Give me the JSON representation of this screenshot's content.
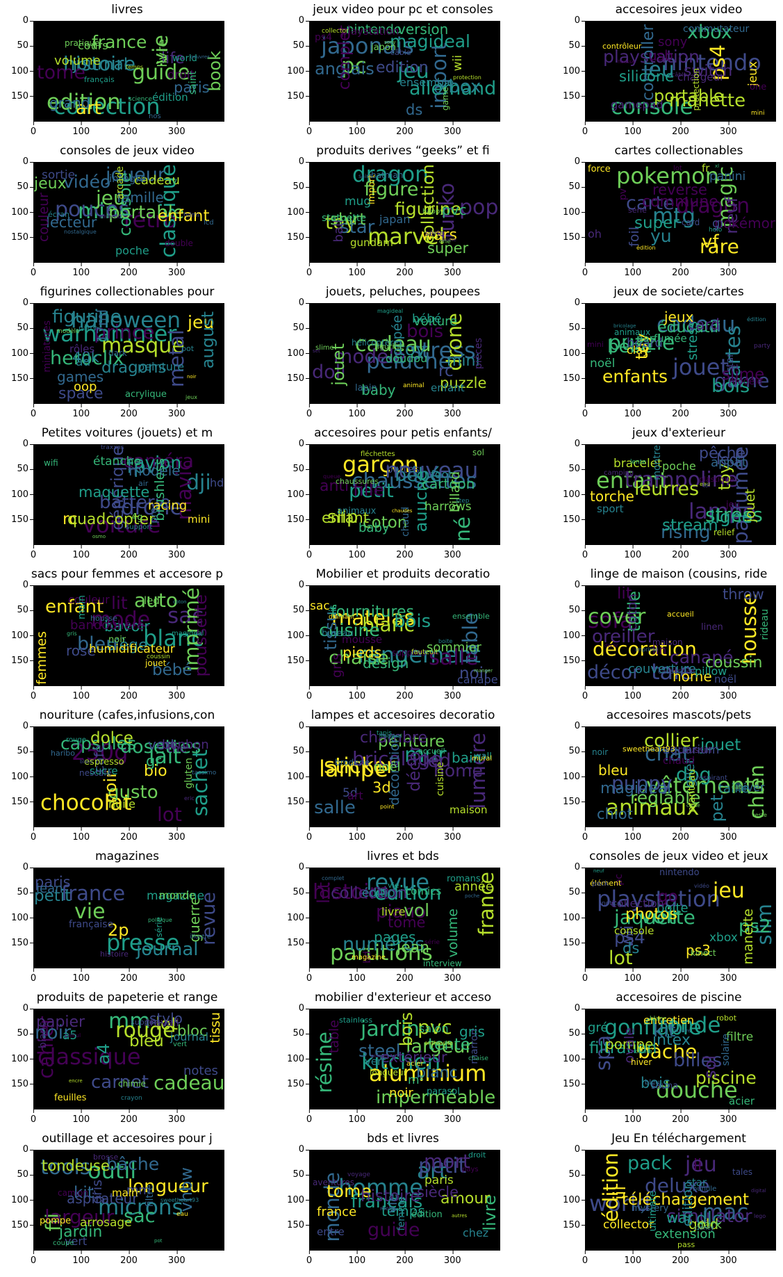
{
  "chart_data": {
    "type": "wordcloud",
    "layout": "8 rows x 3 columns grid of word clouds",
    "axes": {
      "yticks": [
        0,
        50,
        100,
        150
      ],
      "xticks": [
        0,
        100,
        200,
        300
      ],
      "ylim": [
        200,
        0
      ],
      "xlim": [
        0,
        400
      ]
    },
    "palette": [
      "#440154",
      "#482878",
      "#3e4a89",
      "#31688e",
      "#26828e",
      "#1f9e89",
      "#35b779",
      "#6ece58",
      "#b5de2b",
      "#fde725"
    ],
    "panels": [
      {
        "title": "livres",
        "words": [
          "collection",
          "edition",
          "guide",
          "vie",
          "histoire",
          "tome",
          "art",
          "france",
          "book",
          "journal",
          "life",
          "paris",
          "grand",
          "livre",
          "volume",
          "droit",
          "cours",
          "édition",
          "saint",
          "world",
          "pratique",
          "français",
          "nos",
          "science",
          "temps",
          "oeuvres"
        ]
      },
      {
        "title": "jeux video pour pc et consoles",
        "words": [
          "japonais",
          "pc",
          "jeu",
          "import",
          "allemand",
          "xbox",
          "magideal",
          "anglais",
          "complet",
          "edition",
          "ds",
          "version",
          "nintendo",
          "wii",
          "ensemble",
          "playstation",
          "ps4",
          "japon",
          "game",
          "câble",
          "collector",
          "protection",
          "sony"
        ]
      },
      {
        "title": "accesoires jeux video",
        "words": [
          "nintendo",
          "console",
          "jeu",
          "ps4",
          "xbox",
          "manette",
          "playstation",
          "portable",
          "controller",
          "switch",
          "silicone",
          "usb",
          "sony",
          "jeux",
          "gamepad",
          "chargeur",
          "commutateur",
          "one",
          "protection",
          "contrôleur",
          "mini",
          "câble",
          "housse"
        ]
      },
      {
        "title": "consoles de jeux video",
        "words": [
          "rétro",
          "mini",
          "pouces",
          "classique",
          "jeu",
          "joueur",
          "portable",
          "vidéo",
          "console",
          "enfant",
          "jeux",
          "lecteur",
          "famille",
          "couleur",
          "cadeau",
          "sortie",
          "poche",
          "intégré",
          "arcade",
          "tv",
          "double",
          "écran",
          "lcd",
          "hdmi",
          "nostalgique",
          "nintendo"
        ]
      },
      {
        "title": "produits derives “geeks” et fi",
        "words": [
          "marvel",
          "dragon",
          "pop",
          "funko",
          "toy",
          "figure",
          "star",
          "figurine",
          "collection",
          "shirt",
          "wars",
          "super",
          "pvc",
          "ball",
          "mug",
          "japan",
          "gundam",
          "statuette",
          "import",
          "batman",
          "série",
          "happy",
          "one",
          "saint",
          "anime"
        ]
      },
      {
        "title": "cartes collectionables",
        "words": [
          "pokemon",
          "mtg",
          "dragon",
          "magic",
          "rare",
          "carte",
          "vf",
          "yu",
          "neuf",
          "super",
          "commune",
          "reverse",
          "pokémon",
          "foil",
          "gi",
          "panini",
          "oh",
          "fr",
          "pv",
          "force",
          "card",
          "série",
          "lot",
          "holo",
          "édition",
          "xl"
        ]
      },
      {
        "title": "figurines collectionables pour",
        "words": [
          "warhammer",
          "halloween",
          "masque",
          "metal",
          "prince",
          "heroclix",
          "figurine",
          "jeu",
          "august",
          "dragons",
          "space",
          "40k",
          "games",
          "17ml",
          "oop",
          "ad",
          "peinture",
          "rôles",
          "miniatures",
          "acrylique",
          "dark",
          "pot",
          "party",
          "modèle",
          "jeux",
          "noir"
        ]
      },
      {
        "title": "jouets, peluches, poupees",
        "words": [
          "stress",
          "peluche",
          "cadeau",
          "drone",
          "modèle",
          "doll",
          "bois",
          "toy",
          "jouet",
          "rc",
          "mini",
          "puzzle",
          "baby",
          "poupée",
          "voiture",
          "bébé",
          "doudou",
          "enfant",
          "pièces",
          "lapin",
          "hélicoptère",
          "figurine",
          "slime",
          "animal",
          "magideal",
          "set"
        ]
      },
      {
        "title": "jeux de societe/cartes",
        "words": [
          "jouet",
          "cadeau",
          "puzzle",
          "cartes",
          "game",
          "bois",
          "bébé",
          "enfants",
          "toy",
          "slime",
          "éducatif",
          "card",
          "jeux",
          "stress",
          "board",
          "noël",
          "clay",
          "parfumée",
          "star",
          "modèle",
          "animaux",
          "mini",
          "set",
          "party",
          "édition",
          "bricolage"
        ]
      },
      {
        "title": "Petites voitures (jouets) et m",
        "words": [
          "voiture",
          "drone",
          "dji",
          "mavic",
          "fpv",
          "caméra",
          "batterie",
          "avion",
          "générique",
          "rc",
          "quadcopter",
          "maquette",
          "modèle",
          "brushless",
          "racing",
          "étanche",
          "hd",
          "mini",
          "pro",
          "4g",
          "wifi",
          "air",
          "support",
          "traxxas",
          "sac",
          "osmo"
        ]
      },
      {
        "title": "accesoires pour petis enfants/",
        "words": [
          "garçon",
          "nouveau",
          "chaussettes",
          "né",
          "petit",
          "bébé",
          "slip",
          "fille",
          "auucne",
          "coton",
          "anti",
          "enfant",
          "cartoon",
          "billard",
          "baby",
          "harrows",
          "foot",
          "bottes",
          "chaud",
          "animaux",
          "sol",
          "chaussures",
          "fléchettes",
          "step",
          "queue",
          "chaudes"
        ]
      },
      {
        "title": "jeux d'exterieur",
        "words": [
          "enfant",
          "lampe",
          "trampoline",
          "parfumée",
          "stress",
          "leurres",
          "rising",
          "ligne",
          "toy",
          "stream",
          "pêche",
          "led",
          "torche",
          "jouet",
          "appât",
          "bracelet",
          "poche",
          "sport",
          "montre",
          "jeu",
          "relief",
          "plastique",
          "camping",
          "lente",
          "eau",
          "t6"
        ]
      },
      {
        "title": "sacs pour femmes et accesore p",
        "words": [
          "blanc",
          "sac",
          "mode",
          "imprimé",
          "auto",
          "bleu",
          "enfant",
          "lit",
          "poussette",
          "bébé",
          "siège",
          "bavoir",
          "rose",
          "femmes",
          "bandoulière",
          "humidificateur",
          "couleur",
          "led",
          "main",
          "noir",
          "jouet",
          "housse",
          "magideal",
          "coussin",
          "gris",
          "coton"
        ]
      },
      {
        "title": "Mobilier et produits decoratio",
        "words": [
          "rangement",
          "salle",
          "matelas",
          "table",
          "blanc",
          "chaise",
          "bois",
          "cuisine",
          "tissu",
          "noir",
          "fournitures",
          "pieds",
          "design",
          "gris",
          "sommier",
          "sac",
          "canape",
          "mousse",
          "lit",
          "bureau",
          "supplies",
          "ensemble",
          "fauteuil",
          "diamant",
          "boite",
          "manger"
        ]
      },
      {
        "title": "linge de maison (cousins, ride",
        "words": [
          "taie",
          "sofa",
          "cover",
          "housse",
          "décoration",
          "décor",
          "oreiller",
          "canapé",
          "taille",
          "lit",
          "coussin",
          "throw",
          "home",
          "coton",
          "couverture",
          "lin",
          "pillow",
          "noël",
          "rideau",
          "linen",
          "maison",
          "accueil",
          "case",
          "festival",
          "imprimé",
          "décor"
        ]
      },
      {
        "title": "nouriture (cafes,infusions,con",
        "words": [
          "250g",
          "chocolat",
          "lait",
          "sachet",
          "lot",
          "dosettes",
          "gusto",
          "capsules",
          "noir",
          "dolce",
          "bio",
          "gr",
          "vert",
          "café",
          "bonbon",
          "thé",
          "huile",
          "sucre",
          "gluten",
          "espresso",
          "nescafé",
          "haribo",
          "rouge",
          "tassimo",
          "eric",
          "blanc"
        ]
      },
      {
        "title": "lampes et accesoires decoratio",
        "words": [
          "lampe",
          "sticker",
          "mur",
          "lumière",
          "bricolage",
          "led",
          "salle",
          "home",
          "décor",
          "peinture",
          "chambre",
          "3d",
          "bain",
          "décoration",
          "noël",
          "5d",
          "art",
          "maison",
          "cuisine",
          "wall",
          "broderie",
          "accueil",
          "mural",
          "tapis",
          "point",
          "magideal"
        ]
      },
      {
        "title": "accesoires mascots/pets",
        "words": [
          "vêtements",
          "animaux",
          "chat",
          "chien",
          "puppy",
          "dog",
          "collier",
          "réglable",
          "pet",
          "jouet",
          "magideal",
          "chiot",
          "bleu",
          "gilet",
          "taille",
          "aquarium",
          "hiver",
          "chaud",
          "manteau",
          "coussin",
          "noir",
          "sweetheart93",
          "respirant",
          "cat",
          "veste",
          "corde"
        ]
      },
      {
        "title": "magazines",
        "words": [
          "presse",
          "vie",
          "france",
          "revue",
          "journal",
          "2p",
          "petit",
          "paris",
          "guerre",
          "jean",
          "magazine",
          "monde",
          "française",
          "série",
          "histoire",
          "illustré",
          "politique"
        ]
      },
      {
        "title": "livres et bds",
        "words": [
          "revue",
          "partitions",
          "histoire",
          "france",
          "edition",
          "numéros",
          "piano",
          "vol",
          "lot",
          "collection",
          "jean",
          "tome",
          "pages",
          "volume",
          "année",
          "édition",
          "livre",
          "comics",
          "bd",
          "romans",
          "interview",
          "vie",
          "magazine",
          "série",
          "complet",
          "poche"
        ]
      },
      {
        "title": "consoles de jeux video et jeux",
        "words": [
          "playstation",
          "voir",
          "jeu",
          "slim",
          "jaquette",
          "lot",
          "ps2",
          "ps4",
          "wii",
          "go",
          "photos",
          "ds",
          "ps3",
          "manette",
          "boite",
          "xbox",
          "collection",
          "console",
          "pc",
          "nintendo",
          "kinect",
          "élément",
          "pack",
          "notice",
          "vidéo",
          "neuf"
        ]
      },
      {
        "title": "produits de papeterie et range",
        "words": [
          "classique",
          "mm",
          "rouge",
          "cahier",
          "cadeau",
          "noir",
          "carnet",
          "lot",
          "a4",
          "bleu",
          "papier",
          "bloc",
          "stylo",
          "tissu",
          "notes",
          "a5",
          "journal",
          "travail",
          "blanc",
          "feuilles",
          "chimie",
          "support",
          "vert",
          "crayon",
          "calcul",
          "encre"
        ]
      },
      {
        "title": "mobilier d'exterieur et acceso",
        "words": [
          "aluminium",
          "kitchen",
          "jardin",
          "résine",
          "pvc",
          "largeur",
          "imperméable",
          "steel",
          "bois",
          "tente",
          "blanc",
          "extérieur",
          "gris",
          "table",
          "noir",
          "m²",
          "salon",
          "vert",
          "marron",
          "parasol",
          "longueur",
          "stainless",
          "acier",
          "chaise",
          "anthracite",
          "piante"
        ]
      },
      {
        "title": "accesoires de piscine",
        "words": [
          "douche",
          "ronde",
          "gonflable",
          "spa",
          "bâche",
          "billes",
          "kit",
          "piscine",
          "sol",
          "filtration",
          "intex",
          "bois",
          "pompe",
          "ovale",
          "gré",
          "filtre",
          "entretien",
          "acier",
          "solaire",
          "sauna",
          "hiver",
          "robot",
          "bleu",
          "blanc",
          "chlore",
          "tubulaire"
        ]
      },
      {
        "title": "outillage et accesoires pour j",
        "words": [
          "outil",
          "microns",
          "tools",
          "fil",
          "largeur",
          "sac",
          "longueur",
          "bâche",
          "vhbw",
          "kit",
          "jardin",
          "tondeuse",
          "aspirateur",
          "gris",
          "mm",
          "arrosage",
          "vert",
          "main",
          "filtre",
          "pompe",
          "camion",
          "brosse",
          "coupe",
          "eau",
          "sweetheart93",
          "pot"
        ]
      },
      {
        "title": "bds et livres",
        "words": [
          "homme",
          "art",
          "petit",
          "monde",
          "mort",
          "guide",
          "français",
          "tome",
          "livre",
          "histoire",
          "amour",
          "siècle",
          "temps",
          "vie",
          "france",
          "paris",
          "chez",
          "entre",
          "femme",
          "édition",
          "aventures",
          "droit",
          "pays",
          "voyage",
          "mots",
          "autres"
        ]
      },
      {
        "title": "Jeu En téléchargement",
        "words": [
          "world",
          "mac",
          "jeu",
          "édition",
          "deluxe",
          "pack",
          "simulator",
          "dlc",
          "iii",
          "téléchargement",
          "ii",
          "war",
          "gold",
          "edition",
          "extension",
          "collector",
          "dark",
          "star",
          "ultimate",
          "mystery",
          "tales",
          "pass",
          "bundle",
          "clancy",
          "lego",
          "digital"
        ]
      }
    ]
  }
}
